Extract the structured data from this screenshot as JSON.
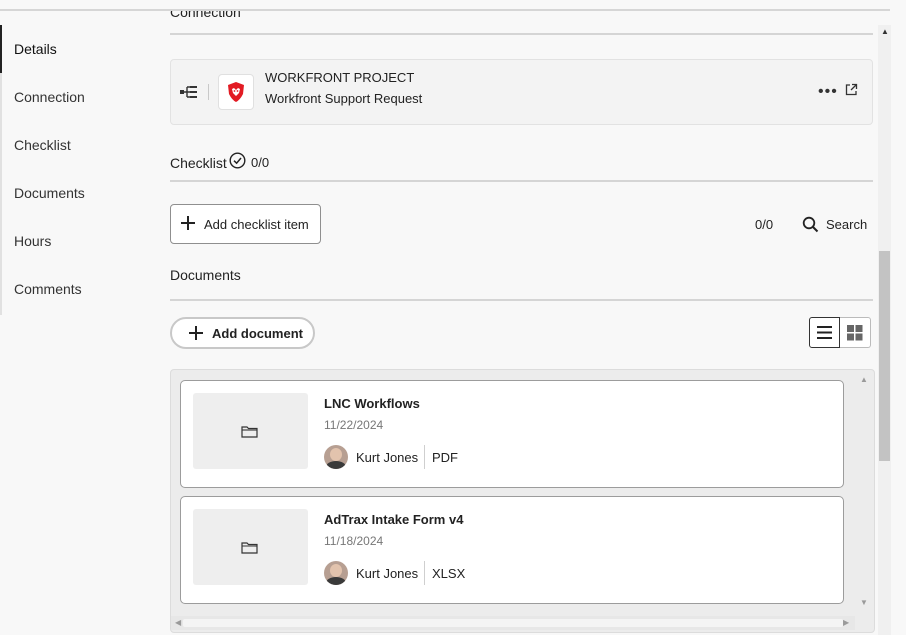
{
  "sidebar": {
    "items": [
      {
        "label": "Details"
      },
      {
        "label": "Connection"
      },
      {
        "label": "Checklist"
      },
      {
        "label": "Documents"
      },
      {
        "label": "Hours"
      },
      {
        "label": "Comments"
      }
    ],
    "active": "Details"
  },
  "connection": {
    "heading": "Connection",
    "card": {
      "type_label": "WORKFRONT PROJECT",
      "name": "Workfront Support Request",
      "more_label": "•••"
    }
  },
  "checklist": {
    "heading": "Checklist",
    "count": "0/0",
    "add_label": "Add checklist item",
    "counter": "0/0",
    "search_label": "Search"
  },
  "documents": {
    "heading": "Documents",
    "add_label": "Add document",
    "view_mode": "list",
    "items": [
      {
        "name": "LNC Workflows",
        "date": "11/22/2024",
        "owner": "Kurt Jones",
        "type": "PDF"
      },
      {
        "name": "AdTrax Intake Form v4",
        "date": "11/18/2024",
        "owner": "Kurt Jones",
        "type": "XLSX"
      }
    ]
  },
  "colors": {
    "brand_red": "#e21b23",
    "active_indicator": "#222222"
  }
}
